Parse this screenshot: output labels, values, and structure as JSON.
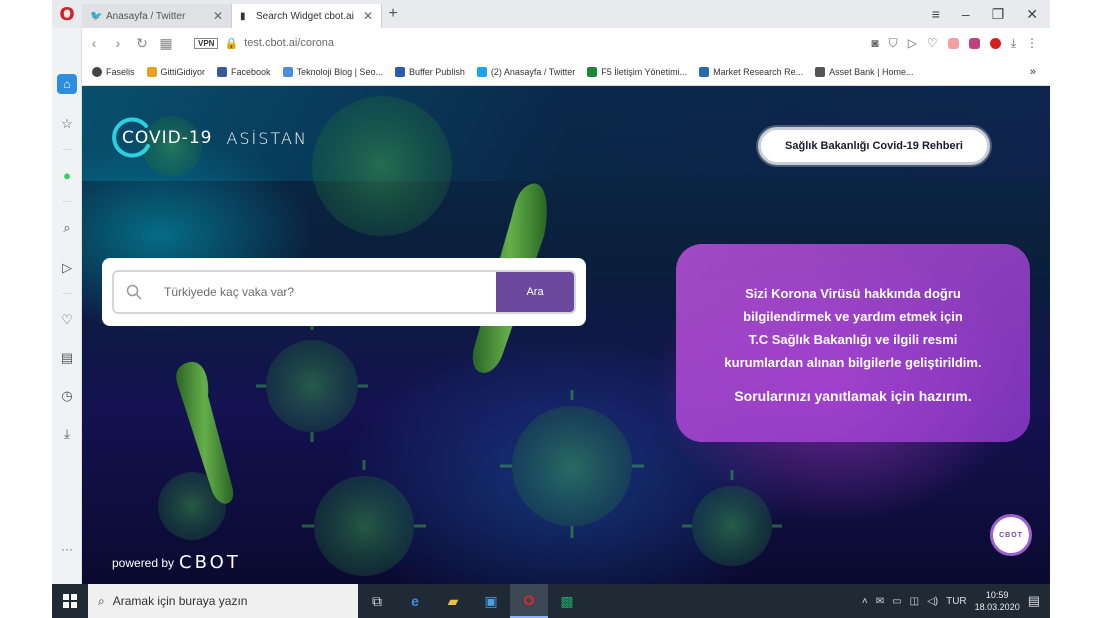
{
  "browser": {
    "logo": "O",
    "tabs": [
      {
        "label": "Anasayfa / Twitter",
        "icon": "twitter-icon",
        "active": false
      },
      {
        "label": "Search Widget cbot.ai",
        "icon": "page-icon",
        "active": true
      }
    ],
    "new_tab": "+",
    "url": "test.cbot.ai/corona",
    "vpn": "VPN",
    "bookmarks": [
      {
        "label": "Faselis",
        "color": "#444444"
      },
      {
        "label": "GittiGidiyor",
        "color": "#e8a020"
      },
      {
        "label": "Facebook",
        "color": "#3b5998"
      },
      {
        "label": "Teknoloji Blog | Seo...",
        "color": "#4a90d9"
      },
      {
        "label": "Buffer Publish",
        "color": "#2a5db0"
      },
      {
        "label": "(2) Anasayfa / Twitter",
        "color": "#1da1f2"
      },
      {
        "label": "F5 İletişim Yönetimi...",
        "color": "#1a8a3a"
      },
      {
        "label": "Market Research Re...",
        "color": "#2a6ab0"
      },
      {
        "label": "Asset Bank | Home...",
        "color": "#555555"
      }
    ],
    "bookmarks_more": "»"
  },
  "page": {
    "logo_main": "COVID-19",
    "logo_sub": "ASİSTAN",
    "guide_button": "Sağlık Bakanlığı Covid-19 Rehberi",
    "search": {
      "placeholder": "Türkiyede kaç vaka var?",
      "button": "Ara"
    },
    "info": {
      "lines": [
        "Sizi Korona Virüsü hakkında doğru",
        "bilgilendirmek ve yardım etmek için",
        "T.C Sağlık Bakanlığı ve ilgili resmi",
        "kurumlardan alınan bilgilerle geliştirildim."
      ],
      "cta": "Sorularınızı yanıtlamak için hazırım."
    },
    "powered_by": "powered by",
    "powered_brand": "CBOT",
    "chat_label": "CBOT"
  },
  "taskbar": {
    "search_placeholder": "Aramak için buraya yazın",
    "language": "TUR",
    "time": "10:59",
    "date": "18.03.2020"
  },
  "colors": {
    "accent_purple": "#6b4a9e",
    "info_card": "#be50dc",
    "opera_red": "#d61f26"
  }
}
